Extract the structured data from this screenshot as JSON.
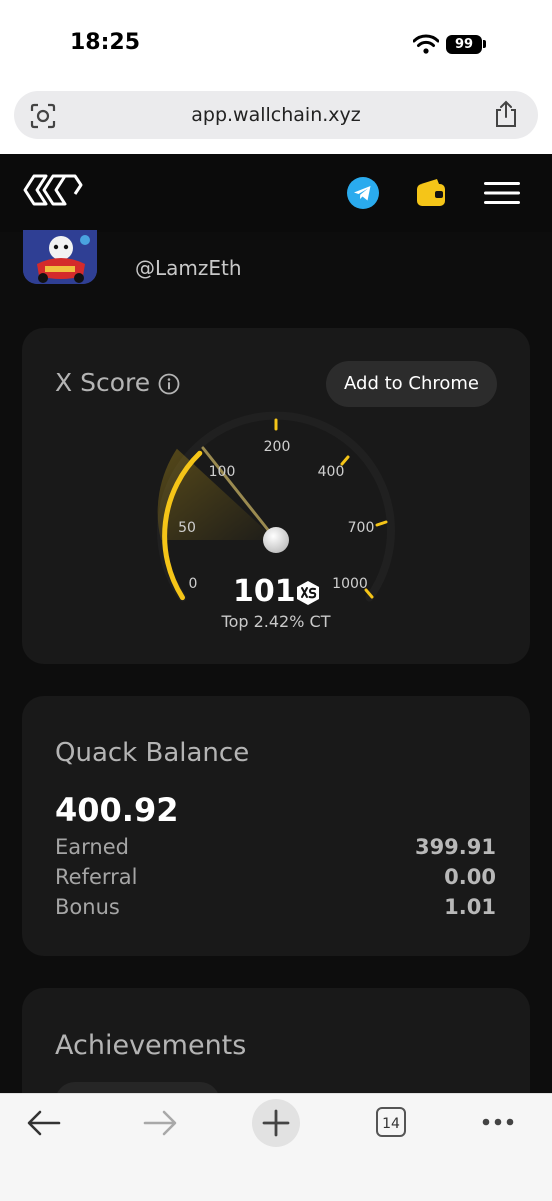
{
  "status": {
    "time": "18:25",
    "battery": "99"
  },
  "browser": {
    "url": "app.wallchain.xyz",
    "tab_count": "14"
  },
  "profile": {
    "handle": "@LamzEth"
  },
  "x_score": {
    "title": "X Score",
    "add_button": "Add to Chrome",
    "score": "101",
    "rank_text": "Top 2.42% CT",
    "gauge_labels": [
      "0",
      "50",
      "100",
      "200",
      "400",
      "700",
      "1000"
    ],
    "accent_color": "#f5c518"
  },
  "quack": {
    "title": "Quack Balance",
    "total": "400.92",
    "rows": [
      {
        "label": "Earned",
        "value": "399.91"
      },
      {
        "label": "Referral",
        "value": "0.00"
      },
      {
        "label": "Bonus",
        "value": "1.01"
      }
    ]
  },
  "achievements": {
    "title": "Achievements"
  }
}
